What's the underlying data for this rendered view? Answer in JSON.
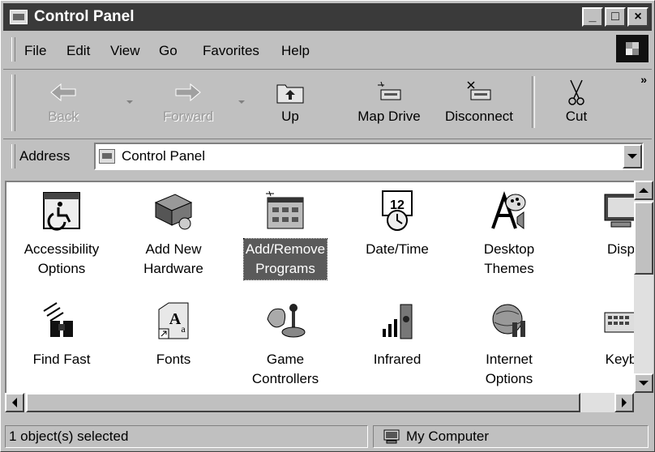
{
  "window": {
    "title": "Control Panel",
    "minimize": "_",
    "maximize": "□",
    "close": "×"
  },
  "menu": [
    "File",
    "Edit",
    "View",
    "Go",
    "Favorites",
    "Help"
  ],
  "toolbar": {
    "back": {
      "label": "Back",
      "icon": "back-arrow-icon"
    },
    "forward": {
      "label": "Forward",
      "icon": "forward-arrow-icon"
    },
    "up": {
      "label": "Up",
      "icon": "up-folder-icon"
    },
    "map_drive": {
      "label": "Map Drive",
      "icon": "map-drive-icon"
    },
    "disconnect": {
      "label": "Disconnect",
      "icon": "disconnect-icon"
    },
    "cut": {
      "label": "Cut",
      "icon": "scissors-icon"
    },
    "more": "»"
  },
  "address": {
    "label": "Address",
    "value": "Control Panel"
  },
  "items": [
    {
      "line1": "Accessibility",
      "line2": "Options",
      "icon": "accessibility-icon"
    },
    {
      "line1": "Add New",
      "line2": "Hardware",
      "icon": "add-hardware-icon"
    },
    {
      "line1": "Add/Remove",
      "line2": "Programs",
      "icon": "add-remove-programs-icon",
      "selected": true
    },
    {
      "line1": "Date/Time",
      "line2": "",
      "icon": "date-time-icon"
    },
    {
      "line1": "Desktop",
      "line2": "Themes",
      "icon": "desktop-themes-icon"
    },
    {
      "line1": "Disp",
      "line2": "",
      "icon": "display-icon"
    },
    {
      "line1": "Find Fast",
      "line2": "",
      "icon": "find-fast-icon"
    },
    {
      "line1": "Fonts",
      "line2": "",
      "icon": "fonts-icon"
    },
    {
      "line1": "Game",
      "line2": "Controllers",
      "icon": "game-controllers-icon"
    },
    {
      "line1": "Infrared",
      "line2": "",
      "icon": "infrared-icon"
    },
    {
      "line1": "Internet",
      "line2": "Options",
      "icon": "internet-options-icon"
    },
    {
      "line1": "Keyb",
      "line2": "",
      "icon": "keyboard-icon"
    }
  ],
  "status": {
    "selection": "1 object(s) selected",
    "location": "My Computer"
  }
}
